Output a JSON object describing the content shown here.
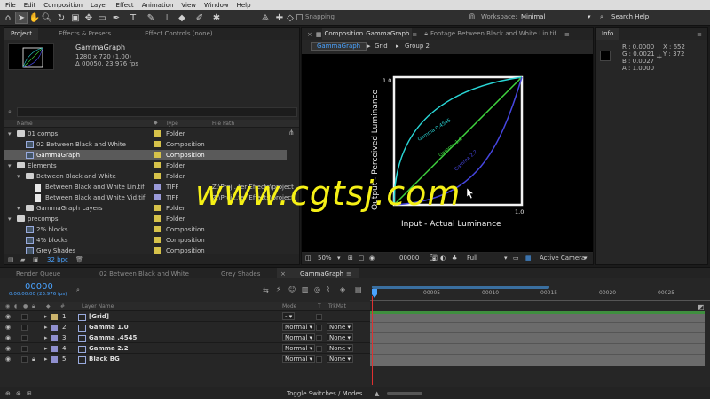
{
  "menu": [
    "File",
    "Edit",
    "Composition",
    "Layer",
    "Effect",
    "Animation",
    "View",
    "Window",
    "Help"
  ],
  "toolbar": {
    "snapping": "Snapping",
    "workspace_label": "Workspace:",
    "workspace_value": "Minimal",
    "search": "Search Help"
  },
  "project": {
    "tabs": [
      "Project",
      "Effects & Presets",
      "Effect Controls (none)"
    ],
    "selected_name": "GammaGraph",
    "selected_size": "1280 x 720 (1.00)",
    "selected_dur": "Δ 00050, 23.976 fps",
    "cols": {
      "name": "Name",
      "type": "Type",
      "path": "File Path"
    },
    "items": [
      {
        "name": "01 comps",
        "type": "Folder",
        "path": "",
        "indent": 0,
        "icon": "folder",
        "color": "#d6c24a",
        "selected": false
      },
      {
        "name": "02 Between Black and White",
        "type": "Composition",
        "path": "",
        "indent": 1,
        "icon": "comp",
        "color": "#d6c24a",
        "selected": false
      },
      {
        "name": "GammaGraph",
        "type": "Composition",
        "path": "",
        "indent": 1,
        "icon": "comp",
        "color": "#d6c24a",
        "selected": true
      },
      {
        "name": "Elements",
        "type": "Folder",
        "path": "",
        "indent": 0,
        "icon": "folder",
        "color": "#d6c24a",
        "selected": false
      },
      {
        "name": "Between Black and White",
        "type": "Folder",
        "path": "",
        "indent": 1,
        "icon": "folder",
        "color": "#d6c24a",
        "selected": false
      },
      {
        "name": "Between Black and White Lin.tif",
        "type": "TIFF",
        "path": "Z:\\Proj...ter Effects\\project",
        "indent": 2,
        "icon": "file",
        "color": "#9a9ad8",
        "selected": false
      },
      {
        "name": "Between Black and White Vid.tif",
        "type": "TIFF",
        "path": "Z:\\Proj...ter Effects\\project",
        "indent": 2,
        "icon": "file",
        "color": "#9a9ad8",
        "selected": false
      },
      {
        "name": "GammaGraph Layers",
        "type": "Folder",
        "path": "",
        "indent": 1,
        "icon": "folder",
        "color": "#d6c24a",
        "selected": false
      },
      {
        "name": "precomps",
        "type": "Folder",
        "path": "",
        "indent": 0,
        "icon": "folder",
        "color": "#d6c24a",
        "selected": false
      },
      {
        "name": "2% blocks",
        "type": "Composition",
        "path": "",
        "indent": 1,
        "icon": "comp",
        "color": "#d6c24a",
        "selected": false
      },
      {
        "name": "4% blocks",
        "type": "Composition",
        "path": "",
        "indent": 1,
        "icon": "comp",
        "color": "#d6c24a",
        "selected": false
      },
      {
        "name": "Grey Shades",
        "type": "Composition",
        "path": "",
        "indent": 1,
        "icon": "comp",
        "color": "#d6c24a",
        "selected": false
      }
    ],
    "bpc": "32 bpc"
  },
  "composition": {
    "tab_label": "Composition",
    "tab_name": "GammaGraph",
    "footage_tab": "Footage Between Black and White Lin.tif",
    "breadcrumbs": [
      "GammaGraph",
      "Grid",
      "Group 2"
    ],
    "graph": {
      "ylabel": "Output - Perceived Luminance",
      "xlabel": "Input - Actual Luminance",
      "one_y": "1.0",
      "one_x": "1.0",
      "curves": [
        {
          "label": "Gamma 0.4545",
          "color": "#29d6d6"
        },
        {
          "label": "Gamma 1.0",
          "color": "#3fd43f"
        },
        {
          "label": "Gamma 2.2",
          "color": "#4646e0"
        }
      ]
    },
    "zoom": "50%",
    "timecode": "00000",
    "resolution": "Full",
    "camera": "Active Camera"
  },
  "info": {
    "title": "Info",
    "r": "R : 0.0000",
    "g": "G : 0.0021",
    "b": "B : 0.0027",
    "a": "A : 1.0000",
    "x": "X : 652",
    "y": "Y : 372"
  },
  "timeline": {
    "tabs": [
      "Render Queue",
      "02 Between Black and White",
      "Grey Shades",
      "GammaGraph"
    ],
    "timecode": "00000",
    "timecode_sub": "0:00:00:00 (23.976 fps)",
    "cols": {
      "num": "#",
      "layer": "Layer Name",
      "mode": "Mode",
      "t": "T",
      "trkmat": "TrkMat"
    },
    "layers": [
      {
        "num": "1",
        "name": "[Grid]",
        "mode": "-",
        "trkmat": "",
        "color": "#c9b26c"
      },
      {
        "num": "2",
        "name": "Gamma 1.0",
        "mode": "Normal",
        "trkmat": "None",
        "color": "#8f8fcf"
      },
      {
        "num": "3",
        "name": "Gamma .4545",
        "mode": "Normal",
        "trkmat": "None",
        "color": "#8f8fcf"
      },
      {
        "num": "4",
        "name": "Gamma 2.2",
        "mode": "Normal",
        "trkmat": "None",
        "color": "#8f8fcf"
      },
      {
        "num": "5",
        "name": "Black BG",
        "mode": "Normal",
        "trkmat": "None",
        "color": "#8f8fcf"
      }
    ],
    "ruler": [
      "00005",
      "00010",
      "00015",
      "00020",
      "00025"
    ],
    "toggle": "Toggle Switches / Modes"
  },
  "watermark": "www.cgtsj.com",
  "colors": {
    "accent": "#4aa3ff",
    "selection": "#5a5a5a",
    "watermark": "#f5f016"
  }
}
